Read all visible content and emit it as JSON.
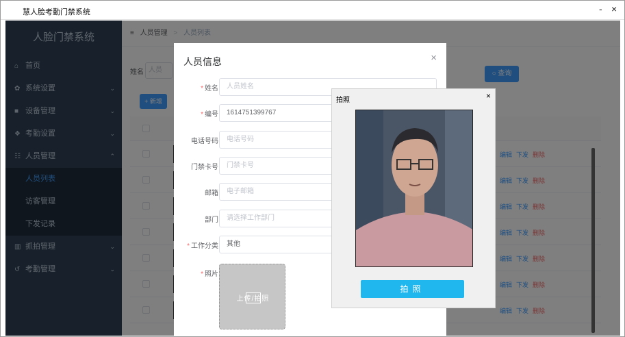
{
  "window": {
    "title": "慧人脸考勤门禁系统",
    "minimize": "-",
    "close": "×"
  },
  "sidebar": {
    "logo": "人脸门禁系统",
    "items": [
      {
        "label": "首页",
        "icon": "home-icon",
        "glyph": "⌂",
        "arrow": ""
      },
      {
        "label": "系统设置",
        "icon": "gear-icon",
        "glyph": "✿",
        "arrow": "⌄"
      },
      {
        "label": "设备管理",
        "icon": "camera-icon",
        "glyph": "■",
        "arrow": "⌄"
      },
      {
        "label": "考勤设置",
        "icon": "gears-icon",
        "glyph": "❖",
        "arrow": "⌄"
      },
      {
        "label": "人员管理",
        "icon": "users-icon",
        "glyph": "☷",
        "arrow": "⌃"
      },
      {
        "label": "人员列表",
        "sub": true,
        "active": true
      },
      {
        "label": "访客管理",
        "sub": true
      },
      {
        "label": "下发记录",
        "sub": true
      },
      {
        "label": "抓拍管理",
        "icon": "trash-icon",
        "glyph": "▥",
        "arrow": "⌄"
      },
      {
        "label": "考勤管理",
        "icon": "history-icon",
        "glyph": "↺",
        "arrow": "⌄"
      }
    ]
  },
  "breadcrumb": {
    "icon": "≡",
    "root": "人员管理",
    "sep": ">",
    "current": "人员列表"
  },
  "search": {
    "label": "姓名",
    "placeholder": "人员",
    "button": "查询",
    "button_icon": "○"
  },
  "add_button": {
    "label": "新增",
    "icon": "+"
  },
  "table": {
    "rows": 7,
    "ops": {
      "edit": "编辑",
      "dispatch": "下发",
      "delete": "删除"
    }
  },
  "dialog": {
    "title": "人员信息",
    "close": "×",
    "fields": [
      {
        "label": "姓名",
        "required": true,
        "value": "",
        "placeholder": "人员姓名"
      },
      {
        "label": "编号",
        "required": true,
        "value": "1614751399767",
        "placeholder": ""
      },
      {
        "label": "电话号码",
        "required": false,
        "value": "",
        "placeholder": "电话号码"
      },
      {
        "label": "门禁卡号",
        "required": false,
        "value": "",
        "placeholder": "门禁卡号"
      },
      {
        "label": "邮箱",
        "required": false,
        "value": "",
        "placeholder": "电子邮箱"
      },
      {
        "label": "部门",
        "required": false,
        "value": "",
        "placeholder": "请选择工作部门"
      },
      {
        "label": "工作分类",
        "required": true,
        "value": "其他",
        "placeholder": ""
      }
    ],
    "photo_label": "照片",
    "upload_text": "上传/拍照"
  },
  "photo_dialog": {
    "title": "拍照",
    "close": "×",
    "shoot_label": "拍照"
  },
  "colors": {
    "sidebar": "#304156",
    "primary": "#409eff",
    "danger": "#f56c6c",
    "shoot": "#20b7ee"
  }
}
